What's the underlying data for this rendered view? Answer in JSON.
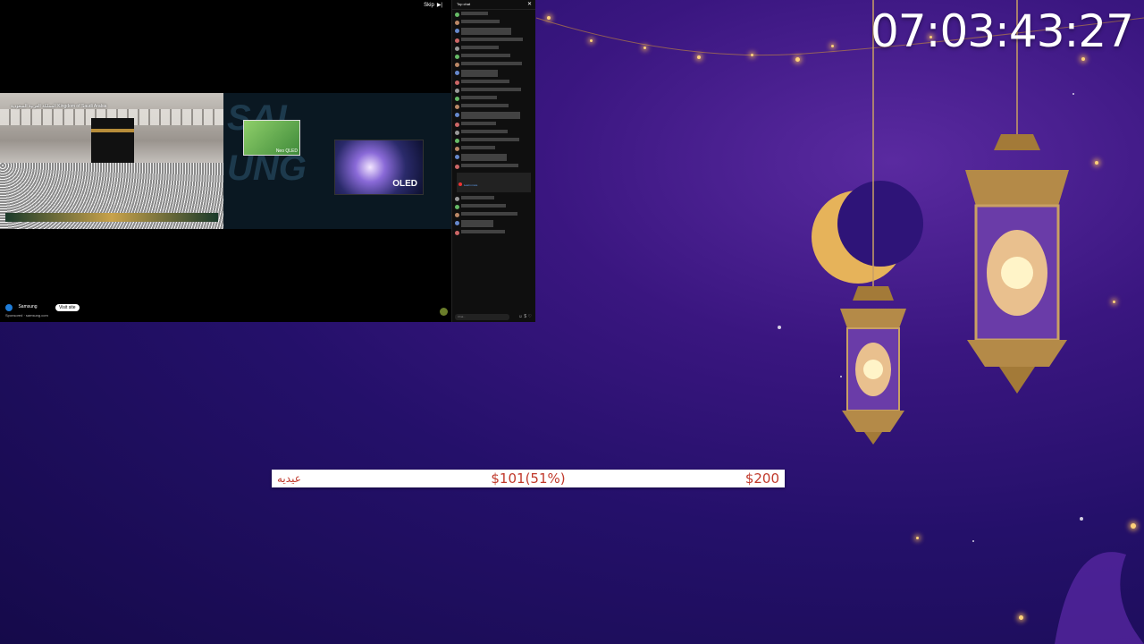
{
  "clock": {
    "time": "07:03:43:27"
  },
  "goal": {
    "name": "عيديه",
    "current": "$101(51%)",
    "target": "$200",
    "progress_fraction": 0.51,
    "colors": {
      "text": "#c0392b",
      "bar": "#ffffff"
    }
  },
  "player": {
    "skip_label": "Skip",
    "video": {
      "channel_label": "المملكة العربية السعودية\nKingdom of Saudi Arabia"
    },
    "ad": {
      "products": [
        {
          "label": "Neo QLED"
        },
        {
          "label": "OLED"
        }
      ],
      "brand": "Samsung",
      "cta_label": "Visit site",
      "sponsor_line": "Sponsored · samsung.com"
    }
  },
  "chat": {
    "header": "Top chat",
    "messages_count_visible": 24,
    "pinned_action": "Learn more",
    "input_placeholder": "Chat..."
  },
  "theme": {
    "background": "#24106a",
    "accent": "#ffb64a"
  }
}
